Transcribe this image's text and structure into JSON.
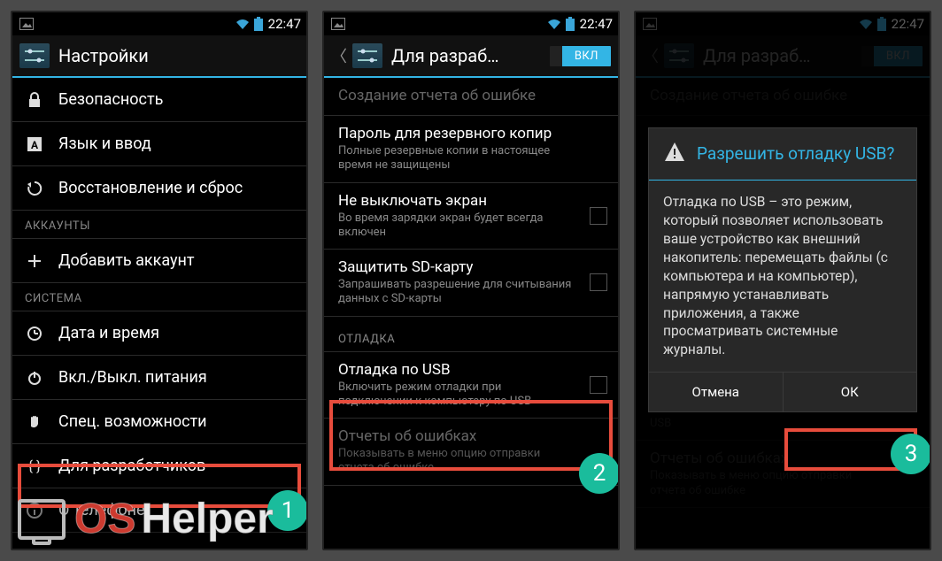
{
  "status": {
    "time": "22:47"
  },
  "screen1": {
    "title": "Настройки",
    "items": [
      {
        "icon": "lock",
        "label": "Безопасность"
      },
      {
        "icon": "lang",
        "label": "Язык и ввод"
      },
      {
        "icon": "restore",
        "label": "Восстановление и сброс"
      }
    ],
    "accounts_header": "Аккаунты",
    "add_account": "Добавить аккаунт",
    "system_header": "Система",
    "system_items": [
      {
        "icon": "clock",
        "label": "Дата и время"
      },
      {
        "icon": "power",
        "label": "Вкл./Выкл. питания"
      },
      {
        "icon": "hand",
        "label": "Спец. возможности"
      },
      {
        "icon": "braces",
        "label": "Для разработчиков"
      },
      {
        "icon": "info",
        "label": "О телефоне"
      }
    ],
    "badge": "1"
  },
  "screen2": {
    "title": "Для разраб…",
    "toggle": "ВКЛ",
    "rows": [
      {
        "title": "Создание отчета об ошибке",
        "sub": "",
        "disabled": true
      },
      {
        "title": "Пароль для резервного копир",
        "sub": "Полные резервные копии в настоящее время не защищены"
      },
      {
        "title": "Не выключать экран",
        "sub": "Во время зарядки экран будет всегда включен",
        "check": true
      },
      {
        "title": "Защитить SD-карту",
        "sub": "Запрашивать разрешение для считывания данных с SD-карты",
        "check": true
      }
    ],
    "debug_header": "Отладка",
    "usb_row": {
      "title": "Отладка по USB",
      "sub": "Включить режим отладки при подключении к компьютеру по USB",
      "check": true
    },
    "reports_row": {
      "title": "Отчеты об ошибках",
      "sub": "Показывать в меню опцию отправки отчета об ошибке"
    },
    "badge": "2"
  },
  "screen3": {
    "title": "Для разраб…",
    "toggle": "ВКЛ",
    "dialog": {
      "title": "Разрешить отладку USB?",
      "body": "Отладка по USB – это режим, который позволяет использовать ваше устройство как внешний накопитель: перемещать файлы (с компьютера и на компьютер), напрямую устанавливать приложения, а также просматривать системные журналы.",
      "cancel": "Отмена",
      "ok": "ОК"
    },
    "bg_rows": {
      "r1": "Создание отчета об ошибке",
      "usb_label": "USB",
      "reports_t": "Отчеты об ошибках",
      "reports_s": "Показывать в меню опцию отправки отчета об ошибке"
    },
    "badge": "3"
  },
  "watermark": {
    "os": "OS",
    "helper": "Helper"
  }
}
